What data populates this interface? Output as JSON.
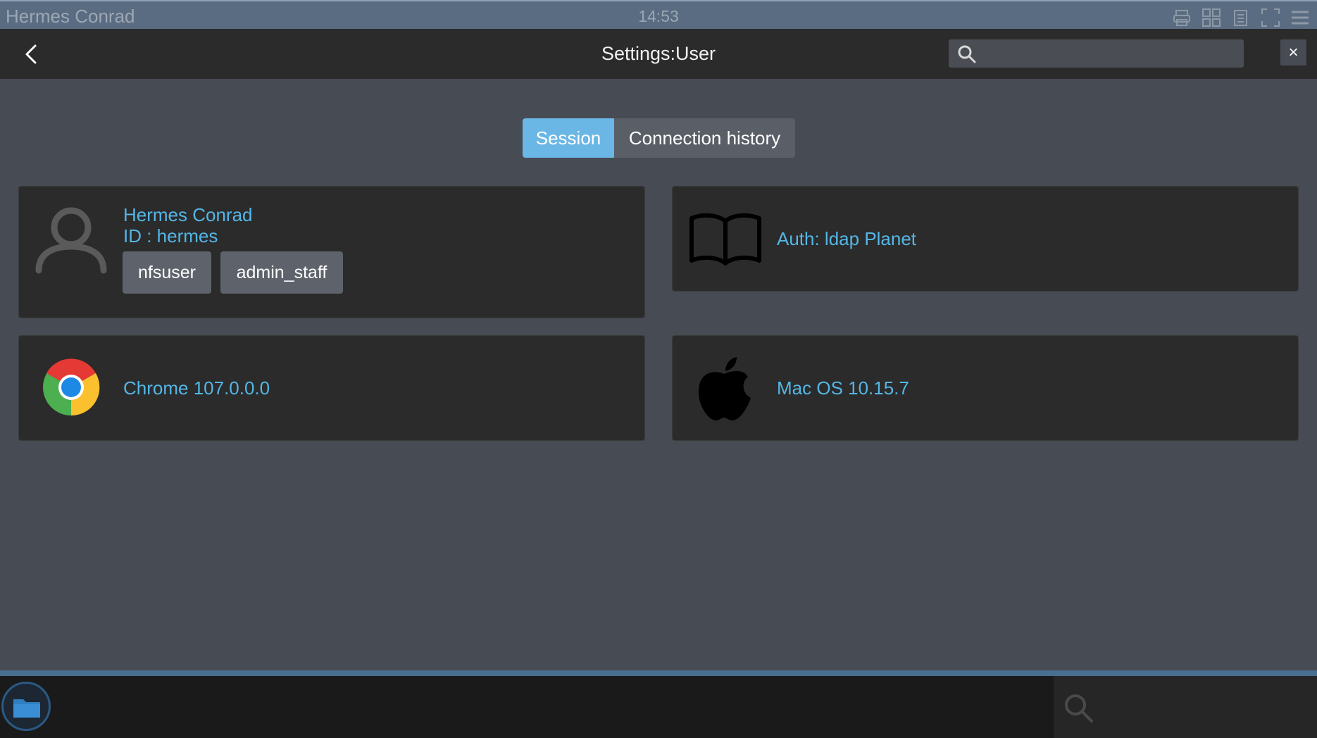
{
  "statusbar": {
    "user": "Hermes Conrad",
    "clock": "14:53",
    "icons": [
      "printer-icon",
      "grid-layout-icon",
      "document-icon",
      "fullscreen-icon",
      "menu-icon"
    ]
  },
  "header": {
    "title": "Settings:User",
    "search_placeholder": "",
    "close_label": "×"
  },
  "tabs": [
    {
      "label": "Session",
      "active": true
    },
    {
      "label": "Connection history",
      "active": false
    }
  ],
  "user_card": {
    "name": "Hermes Conrad",
    "id_text": "ID : hermes",
    "groups": [
      "nfsuser",
      "admin_staff"
    ]
  },
  "auth_card": {
    "label": "Auth: ldap Planet"
  },
  "browser_card": {
    "label": "Chrome 107.0.0.0"
  },
  "os_card": {
    "label": "Mac OS 10.15.7"
  },
  "colors": {
    "accent": "#54b6e6",
    "active_tab": "#6ab7e6",
    "card_bg": "#2b2b2b",
    "page_bg": "#474b53"
  }
}
